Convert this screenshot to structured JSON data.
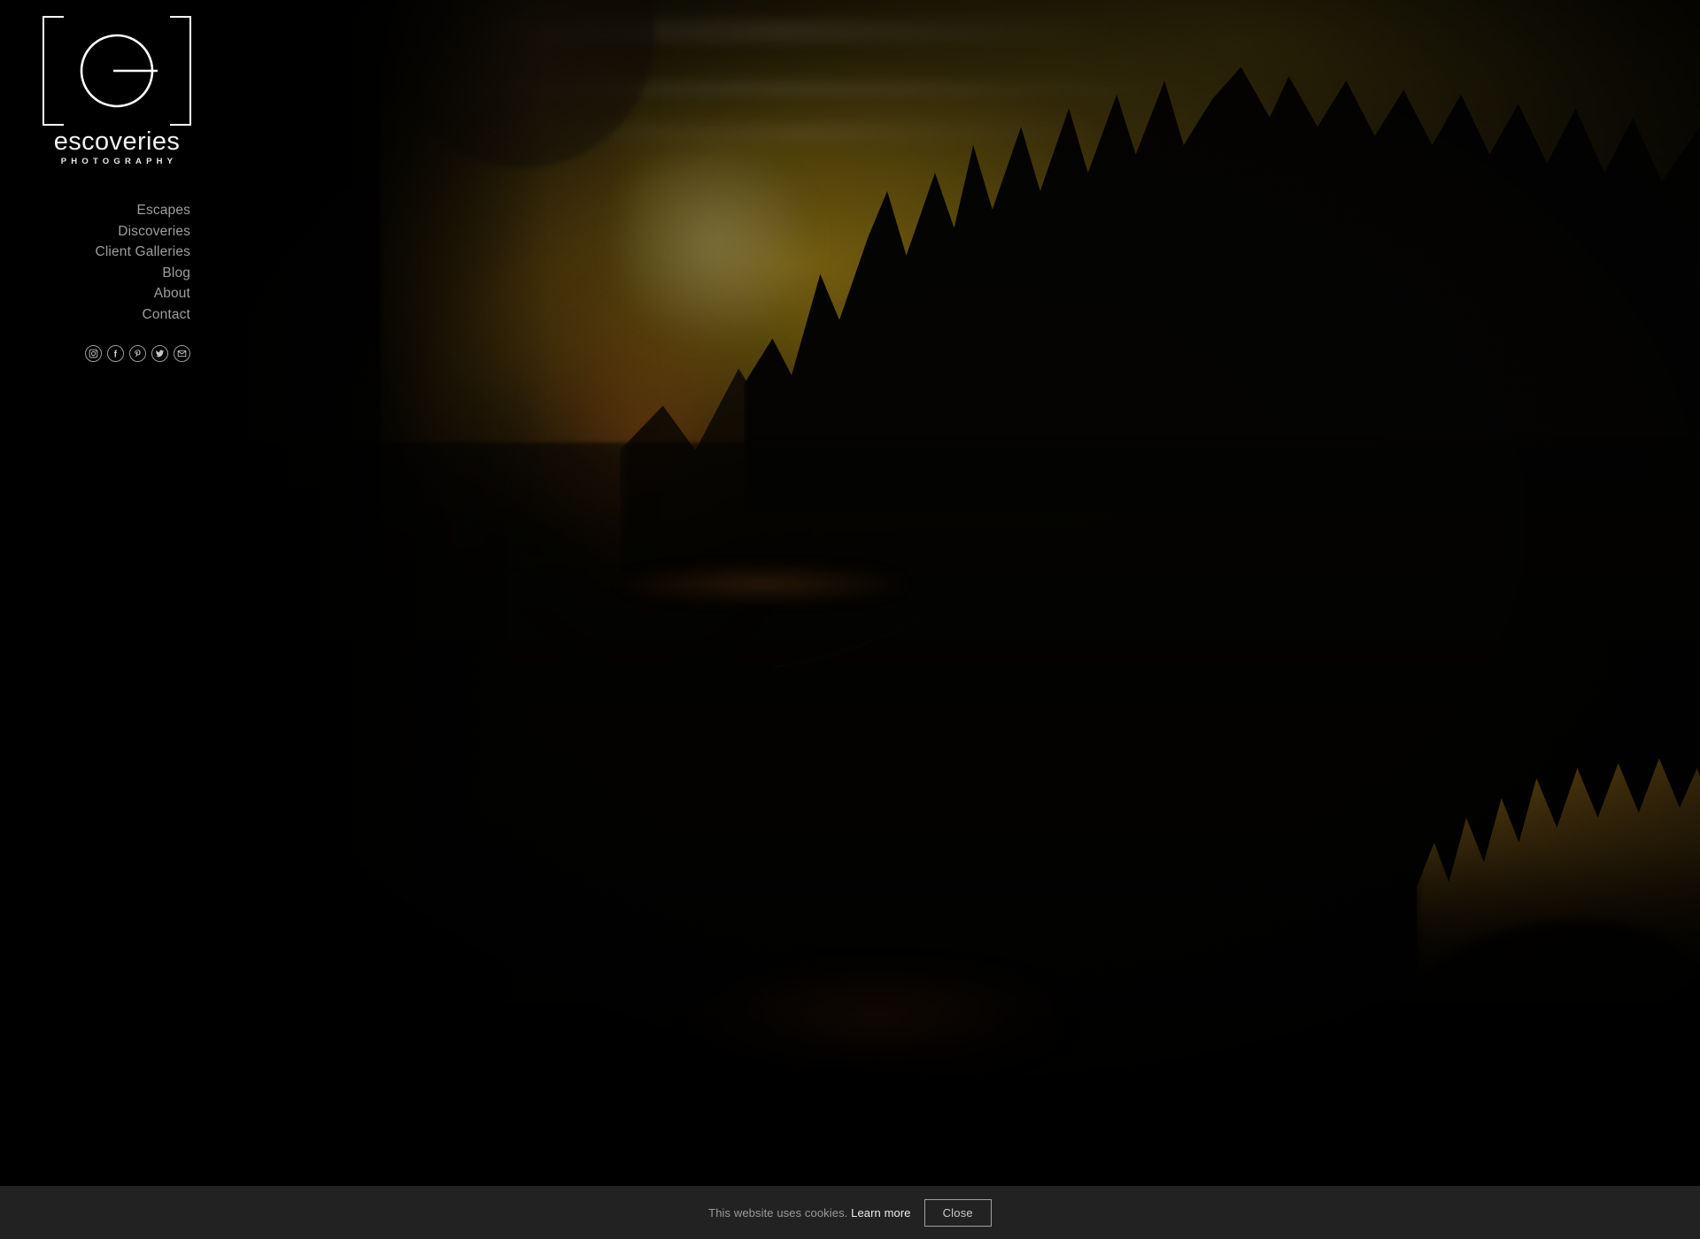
{
  "site": {
    "brand_name": "escoveries",
    "brand_tagline": "PHOTOGRAPHY",
    "logo_letter": "e"
  },
  "nav": {
    "items": [
      {
        "label": "Escapes"
      },
      {
        "label": "Discoveries"
      },
      {
        "label": "Client Galleries"
      },
      {
        "label": "Blog"
      },
      {
        "label": "About"
      },
      {
        "label": "Contact"
      }
    ]
  },
  "social": {
    "items": [
      {
        "name": "instagram-icon",
        "title": "Instagram"
      },
      {
        "name": "facebook-icon",
        "title": "Facebook"
      },
      {
        "name": "pinterest-icon",
        "title": "Pinterest"
      },
      {
        "name": "twitter-icon",
        "title": "Twitter"
      },
      {
        "name": "email-icon",
        "title": "Email"
      }
    ]
  },
  "cookie_banner": {
    "message": "This website uses cookies.",
    "link_label": "Learn more",
    "close_label": "Close"
  },
  "colors": {
    "page_background": "#000000",
    "banner_background": "#222222",
    "nav_text": "#9d9d9d",
    "brand_text": "#f2f2f2",
    "cookie_text": "#9a9a9a",
    "cookie_link": "#ededed",
    "sunset_amber": "#92761a",
    "ridge_amber": "#835e18"
  }
}
